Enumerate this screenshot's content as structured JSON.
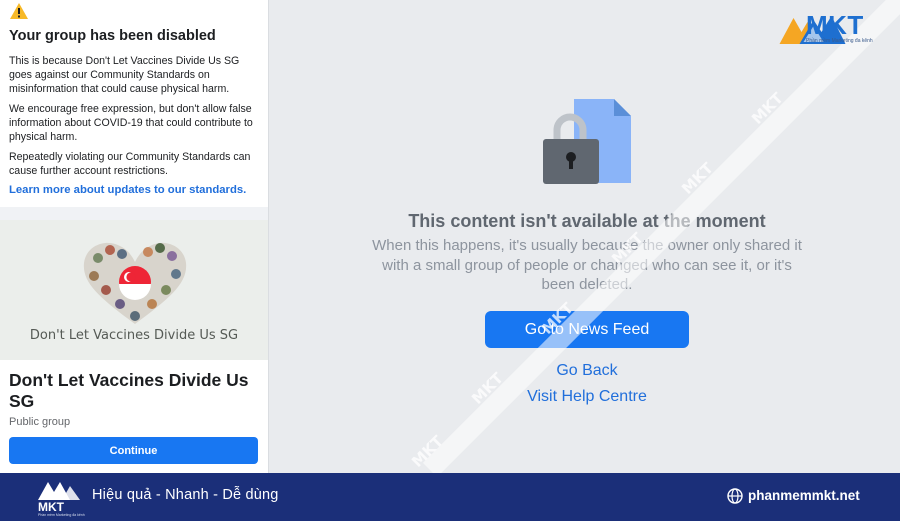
{
  "left_panel": {
    "notice": {
      "title": "Your group has been disabled",
      "para1": "This is because Don't Let Vaccines Divide Us SG goes against our Community Standards on misinformation that could cause physical harm.",
      "para2": "We encourage free expression, but don't allow false information about COVID-19 that could contribute to physical harm.",
      "para3": "Repeatedly violating our Community Standards can cause further account restrictions.",
      "link": "Learn more about updates to our standards."
    },
    "cover_text": "Don't Let Vaccines Divide Us SG",
    "group": {
      "name": "Don't Let Vaccines Divide Us SG",
      "type": "Public group",
      "continue_label": "Continue"
    }
  },
  "main": {
    "title": "This content isn't available at the moment",
    "description": "When this happens, it's usually because the owner only shared it with a small group of people or changed who can see it, or it's been deleted.",
    "news_feed_button": "Go to News Feed",
    "go_back_link": "Go Back",
    "help_link": "Visit Help Centre"
  },
  "brand": {
    "name": "MKT",
    "subtitle": "Phần mềm Marketing đa kênh",
    "watermark_text": "MKT",
    "colors": {
      "blue": "#1e6fd0",
      "orange": "#f5a623",
      "footer": "#1b2f79"
    }
  },
  "footer": {
    "tagline": "Hiệu quả - Nhanh - Dễ dùng",
    "website": "phanmemmkt.net",
    "logo_text": "MKT",
    "logo_sub": "Phần mềm Marketing đa kênh"
  },
  "icons": {
    "warning": "warning-icon",
    "lock": "lock-icon",
    "document": "document-icon",
    "globe": "globe-icon",
    "heart": "heart-illustration"
  }
}
